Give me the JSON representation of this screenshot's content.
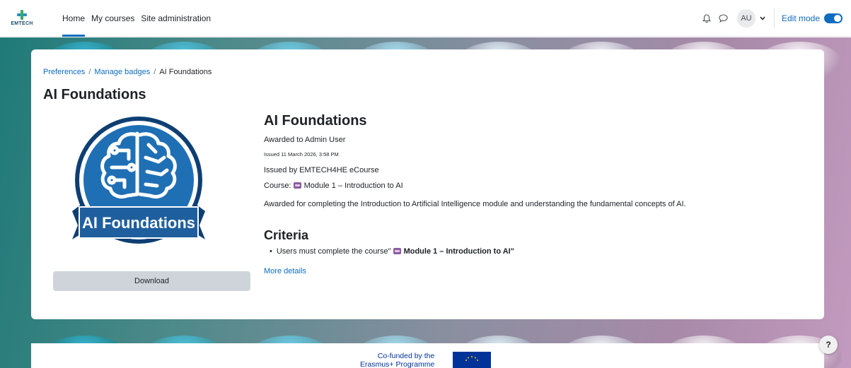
{
  "brand": {
    "logo_text": "EMTECH"
  },
  "nav": {
    "items": [
      {
        "label": "Home",
        "active": true
      },
      {
        "label": "My courses",
        "active": false
      },
      {
        "label": "Site administration",
        "active": false
      }
    ],
    "user_initials": "AU",
    "edit_mode_label": "Edit mode",
    "edit_mode_on": true
  },
  "breadcrumb": {
    "items": [
      "Preferences",
      "Manage badges",
      "AI Foundations"
    ],
    "separator": "/"
  },
  "page_title": "AI Foundations",
  "badge": {
    "image_text": "AI Foundations",
    "name": "AI Foundations",
    "awarded_to": "Awarded to Admin User",
    "issued_date": "Issued 11 March 2026, 3:58 PM",
    "issued_by": "Issued by EMTECH4HE eCourse",
    "course_prefix": "Course:",
    "course_name": "Module 1 – Introduction to AI",
    "description": "Awarded for completing the Introduction to Artificial Intelligence module and understanding the fundamental concepts of AI.",
    "download_label": "Download"
  },
  "criteria": {
    "heading": "Criteria",
    "item_prefix": "Users must complete the course\"",
    "item_course": "Module 1 – Introduction to AI\"",
    "more_details": "More details"
  },
  "footer": {
    "cofund_line1": "Co-funded by the",
    "cofund_line2": "Erasmus+ Programme"
  },
  "help_label": "?",
  "colors": {
    "accent": "#0f6cbf",
    "badge_blue": "#1f6fb5",
    "badge_dark": "#0e3f73"
  }
}
